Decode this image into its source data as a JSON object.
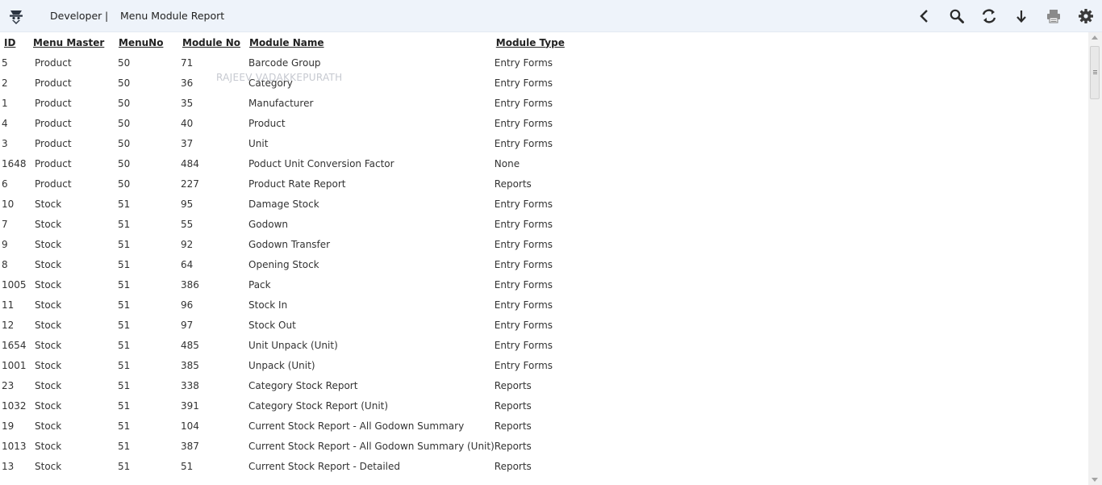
{
  "header": {
    "user": "Developer",
    "separator": "|",
    "page_title": "Menu Module Report",
    "icons": [
      "home-icon",
      "back-icon",
      "search-icon",
      "refresh-icon",
      "download-icon",
      "print-icon",
      "settings-icon"
    ]
  },
  "watermark": "RAJEEV VADAKKEPURATH",
  "table": {
    "columns": {
      "id": "ID",
      "menu_master": "Menu Master",
      "menu_no": "MenuNo",
      "module_no": "Module No",
      "module_name": "Module Name",
      "module_type": "Module Type"
    },
    "rows": [
      {
        "id": "5",
        "menu_master": "Product",
        "menu_no": "50",
        "module_no": "71",
        "module_name": "Barcode Group",
        "module_type": "Entry Forms"
      },
      {
        "id": "2",
        "menu_master": "Product",
        "menu_no": "50",
        "module_no": "36",
        "module_name": "Category",
        "module_type": "Entry Forms"
      },
      {
        "id": "1",
        "menu_master": "Product",
        "menu_no": "50",
        "module_no": "35",
        "module_name": "Manufacturer",
        "module_type": "Entry Forms"
      },
      {
        "id": "4",
        "menu_master": "Product",
        "menu_no": "50",
        "module_no": "40",
        "module_name": "Product",
        "module_type": "Entry Forms"
      },
      {
        "id": "3",
        "menu_master": "Product",
        "menu_no": "50",
        "module_no": "37",
        "module_name": "Unit",
        "module_type": "Entry Forms"
      },
      {
        "id": "1648",
        "menu_master": "Product",
        "menu_no": "50",
        "module_no": "484",
        "module_name": "Poduct Unit Conversion Factor",
        "module_type": "None"
      },
      {
        "id": "6",
        "menu_master": "Product",
        "menu_no": "50",
        "module_no": "227",
        "module_name": "Product Rate Report",
        "module_type": "Reports"
      },
      {
        "id": "10",
        "menu_master": "Stock",
        "menu_no": "51",
        "module_no": "95",
        "module_name": "Damage Stock",
        "module_type": "Entry Forms"
      },
      {
        "id": "7",
        "menu_master": "Stock",
        "menu_no": "51",
        "module_no": "55",
        "module_name": "Godown",
        "module_type": "Entry Forms"
      },
      {
        "id": "9",
        "menu_master": "Stock",
        "menu_no": "51",
        "module_no": "92",
        "module_name": "Godown Transfer",
        "module_type": "Entry Forms"
      },
      {
        "id": "8",
        "menu_master": "Stock",
        "menu_no": "51",
        "module_no": "64",
        "module_name": "Opening Stock",
        "module_type": "Entry Forms"
      },
      {
        "id": "1005",
        "menu_master": "Stock",
        "menu_no": "51",
        "module_no": "386",
        "module_name": "Pack",
        "module_type": "Entry Forms"
      },
      {
        "id": "11",
        "menu_master": "Stock",
        "menu_no": "51",
        "module_no": "96",
        "module_name": "Stock In",
        "module_type": "Entry Forms"
      },
      {
        "id": "12",
        "menu_master": "Stock",
        "menu_no": "51",
        "module_no": "97",
        "module_name": "Stock Out",
        "module_type": "Entry Forms"
      },
      {
        "id": "1654",
        "menu_master": "Stock",
        "menu_no": "51",
        "module_no": "485",
        "module_name": "Unit Unpack (Unit)",
        "module_type": "Entry Forms"
      },
      {
        "id": "1001",
        "menu_master": "Stock",
        "menu_no": "51",
        "module_no": "385",
        "module_name": "Unpack (Unit)",
        "module_type": "Entry Forms"
      },
      {
        "id": "23",
        "menu_master": "Stock",
        "menu_no": "51",
        "module_no": "338",
        "module_name": "Category Stock Report",
        "module_type": "Reports"
      },
      {
        "id": "1032",
        "menu_master": "Stock",
        "menu_no": "51",
        "module_no": "391",
        "module_name": "Category Stock Report (Unit)",
        "module_type": "Reports"
      },
      {
        "id": "19",
        "menu_master": "Stock",
        "menu_no": "51",
        "module_no": "104",
        "module_name": "Current Stock Report - All Godown Summary",
        "module_type": "Reports"
      },
      {
        "id": "1013",
        "menu_master": "Stock",
        "menu_no": "51",
        "module_no": "387",
        "module_name": "Current Stock Report - All Godown Summary (Unit)",
        "module_type": "Reports"
      },
      {
        "id": "13",
        "menu_master": "Stock",
        "menu_no": "51",
        "module_no": "51",
        "module_name": "Current Stock Report - Detailed",
        "module_type": "Reports"
      }
    ]
  }
}
